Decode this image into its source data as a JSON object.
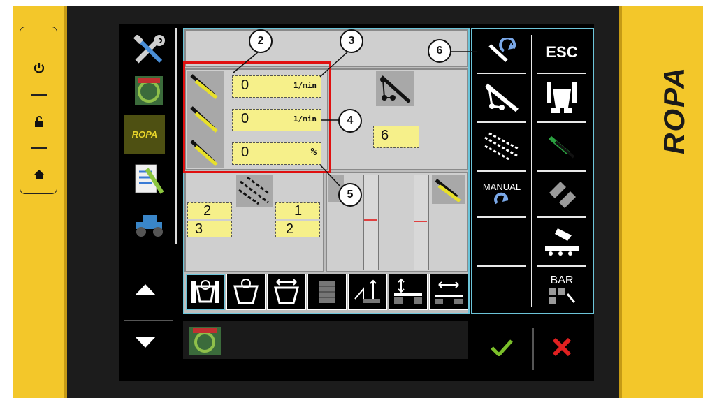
{
  "brand": {
    "logo_text": "ROPA",
    "side_text": "ROPA"
  },
  "fields": {
    "speed1_value": "0",
    "speed1_unit": "1/min",
    "speed2_value": "0",
    "speed2_unit": "1/min",
    "percent_value": "0",
    "percent_unit": "%",
    "count_value": "6",
    "row_a_top": "2",
    "row_a_bottom": "3",
    "row_b_top": "1",
    "row_b_bottom": "2"
  },
  "callouts": [
    "2",
    "3",
    "4",
    "5",
    "6"
  ],
  "right_buttons": {
    "esc": "ESC",
    "manual": "MANUAL",
    "bar": "BAR"
  },
  "colors": {
    "accent_yellow": "#f3c72a",
    "field_yellow": "#f6f08a",
    "highlight_red": "#e01010",
    "frame_cyan": "#6cc4d9",
    "confirm_green": "#7bbf2a",
    "cancel_red": "#e02020"
  }
}
